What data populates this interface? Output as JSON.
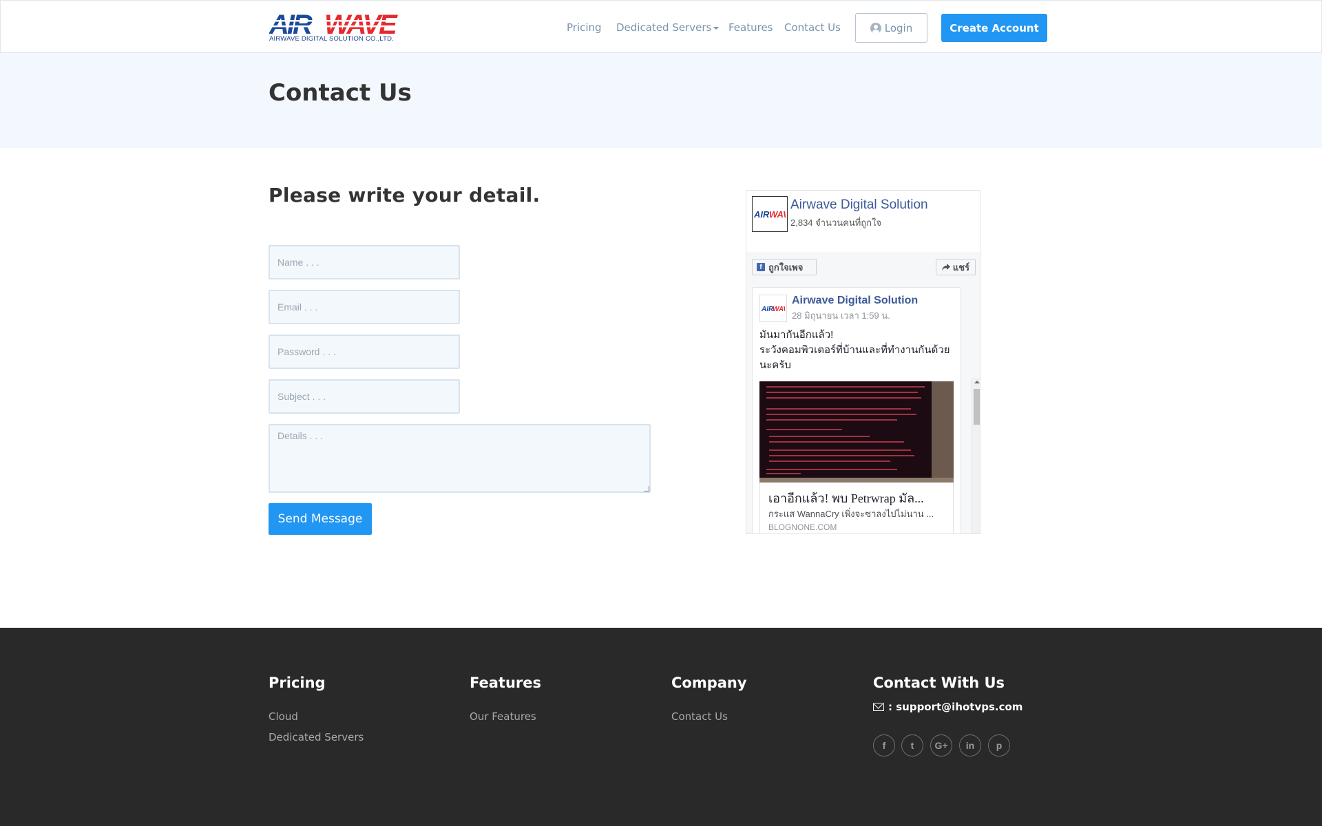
{
  "brand": {
    "logo_text": "AIRWAVE",
    "tagline": "AIRWAVE DIGITAL SOLUTION CO.,LTD.",
    "colors": {
      "blue": "#1b3f8f",
      "red": "#e52a2f"
    }
  },
  "nav": {
    "items": [
      {
        "label": "Pricing"
      },
      {
        "label": "Dedicated Servers",
        "dropdown": true
      },
      {
        "label": "Features"
      },
      {
        "label": "Contact Us"
      }
    ],
    "login_label": "Login",
    "create_label": "Create Account"
  },
  "page": {
    "title": "Contact Us"
  },
  "form": {
    "heading": "Please write your detail.",
    "name_placeholder": "Name . . .",
    "email_placeholder": "Email . . .",
    "password_placeholder": "Password . . .",
    "subject_placeholder": "Subject . . .",
    "details_placeholder": "Details . . .",
    "send_label": "Send Message"
  },
  "facebook": {
    "page_name": "Airwave Digital Solution",
    "likes": "2,834 จำนวนคนที่ถูกใจ",
    "like_label": "ถูกใจเพจ",
    "share_label": "แชร์",
    "post": {
      "author": "Airwave Digital Solution",
      "time": "28 มิถุนายน เวลา 1:59 น.",
      "text": "มันมากันอีกแล้ว!\nระวังคอมพิวเตอร์ที่บ้านและที่ทำงานกันด้วยนะครับ",
      "link_title": "เอาอีกแล้ว! พบ Petrwrap มัล...",
      "link_desc": "กระแส WannaCry เพิ่งจะซาลงไปไม่นาน ...",
      "link_domain": "BLOGNONE.COM"
    }
  },
  "footer": {
    "pricing": {
      "heading": "Pricing",
      "links": [
        "Cloud",
        "Dedicated Servers"
      ]
    },
    "features": {
      "heading": "Features",
      "links": [
        "Our Features"
      ]
    },
    "company": {
      "heading": "Company",
      "links": [
        "Contact Us"
      ]
    },
    "contact": {
      "heading": "Contact With Us",
      "email": ": support@ihotvps.com"
    },
    "social": [
      {
        "icon": "facebook-icon",
        "glyph": "f"
      },
      {
        "icon": "twitter-icon",
        "glyph": "t"
      },
      {
        "icon": "google-plus-icon",
        "glyph": "G+"
      },
      {
        "icon": "linkedin-icon",
        "glyph": "in"
      },
      {
        "icon": "pinterest-icon",
        "glyph": "p"
      }
    ]
  },
  "colors": {
    "accent": "#2196f3",
    "title_band": "#f2f8fd",
    "footer_bg": "#292929",
    "nav_text": "#7a93ae",
    "fb_blue": "#3b5998"
  }
}
